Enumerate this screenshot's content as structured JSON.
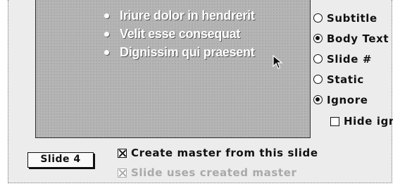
{
  "preview": {
    "bullets": [
      "Iriure dolor in hendrerit",
      "Velit esse consequat",
      "Dignissim qui praesent"
    ],
    "cursor_icon": "arrow-pointer-icon"
  },
  "text_type_options": [
    {
      "label": "Subtitle",
      "selected": false
    },
    {
      "label": "Body Text",
      "selected": true
    },
    {
      "label": "Slide #",
      "selected": false
    },
    {
      "label": "Static",
      "selected": false
    },
    {
      "label": "Ignore",
      "selected": true
    }
  ],
  "hide_ignored": {
    "label": "Hide ign",
    "checked": false
  },
  "slide_button": {
    "label": "Slide 4"
  },
  "options": {
    "create_master": {
      "label": "Create master from this slide",
      "checked": true,
      "enabled": true
    },
    "uses_master": {
      "label": "Slide uses created master",
      "checked": true,
      "enabled": false
    }
  },
  "colors": {
    "preview_bg": "#b4b4b4",
    "window_bg": "#ececec",
    "disabled_text": "#a9a9a9"
  }
}
